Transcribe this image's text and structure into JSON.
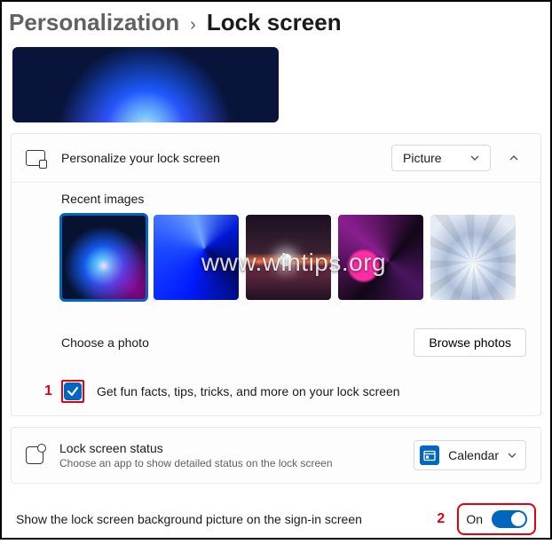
{
  "breadcrumb": {
    "parent": "Personalization",
    "sep": "›",
    "current": "Lock screen"
  },
  "personalize": {
    "label": "Personalize your lock screen",
    "dropdown_value": "Picture"
  },
  "recent": {
    "heading": "Recent images"
  },
  "watermark": "www.wintips.org",
  "choose": {
    "label": "Choose a photo",
    "button": "Browse photos"
  },
  "funfacts": {
    "callout": "1",
    "label": "Get fun facts, tips, tricks, and more on your lock screen",
    "checked": true
  },
  "status": {
    "title": "Lock screen status",
    "subtitle": "Choose an app to show detailed status on the lock screen",
    "app": "Calendar"
  },
  "signin": {
    "label": "Show the lock screen background picture on the sign-in screen",
    "callout": "2",
    "toggle_label": "On",
    "toggle_on": true
  }
}
